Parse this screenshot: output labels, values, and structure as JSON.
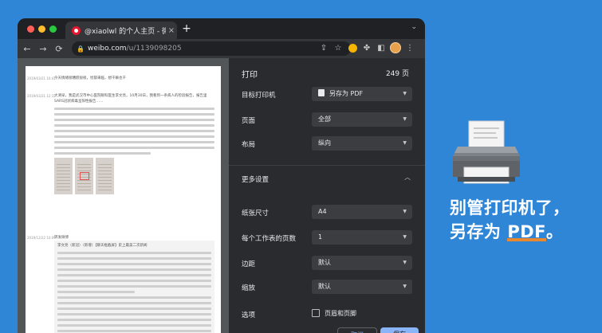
{
  "browser": {
    "tab_title": "@xiaolwl 的个人主页 - 微博",
    "tab_close": "×",
    "new_tab": "+",
    "tab_menu": "⌄",
    "nav": {
      "back": "←",
      "forward": "→",
      "reload": "⟳"
    },
    "url_host": "weibo.com",
    "url_path": "/u/1139098205"
  },
  "page": {
    "posts": [
      {
        "date": "2019/03/21 10:41",
        "text": "今天情绪很糟糕很很，忧郁来临，想干嘛也干"
      },
      {
        "date": "2019/03/21 12:15",
        "text": "大清早，我是武汉市中心医院眼科医生李文亮，10月30日，我看到一条病人的检验报告，报告里SARS冠状病毒呈阳性报告……"
      },
      {
        "date": "2019/12/22 10:09",
        "text": "转发微博"
      }
    ],
    "quote_text": "李文亮（新冠）（新增）【聊天框截屏】史上最美二次新闻"
  },
  "print": {
    "title": "打印",
    "page_count": "249 页",
    "rows": [
      {
        "label": "目标打印机",
        "value": "另存为 PDF"
      },
      {
        "label": "页面",
        "value": "全部"
      },
      {
        "label": "布局",
        "value": "纵向"
      }
    ],
    "more_settings": "更多设置",
    "more_rows": [
      {
        "label": "纸张尺寸",
        "value": "A4"
      },
      {
        "label": "每个工作表的页数",
        "value": "1"
      },
      {
        "label": "边距",
        "value": "默认"
      },
      {
        "label": "缩放",
        "value": "默认"
      }
    ],
    "options_label": "选项",
    "options_check": "页眉和页脚",
    "cancel": "取消",
    "save": "保存"
  },
  "tagline": {
    "line1": "别管打印机了，",
    "line2_prefix": "另存为 ",
    "line2_highlight": "PDF",
    "line2_suffix": "。"
  },
  "colors": {
    "background": "#2f86d6",
    "accent_button": "#8ab4f8",
    "highlight": "#e8892f"
  }
}
